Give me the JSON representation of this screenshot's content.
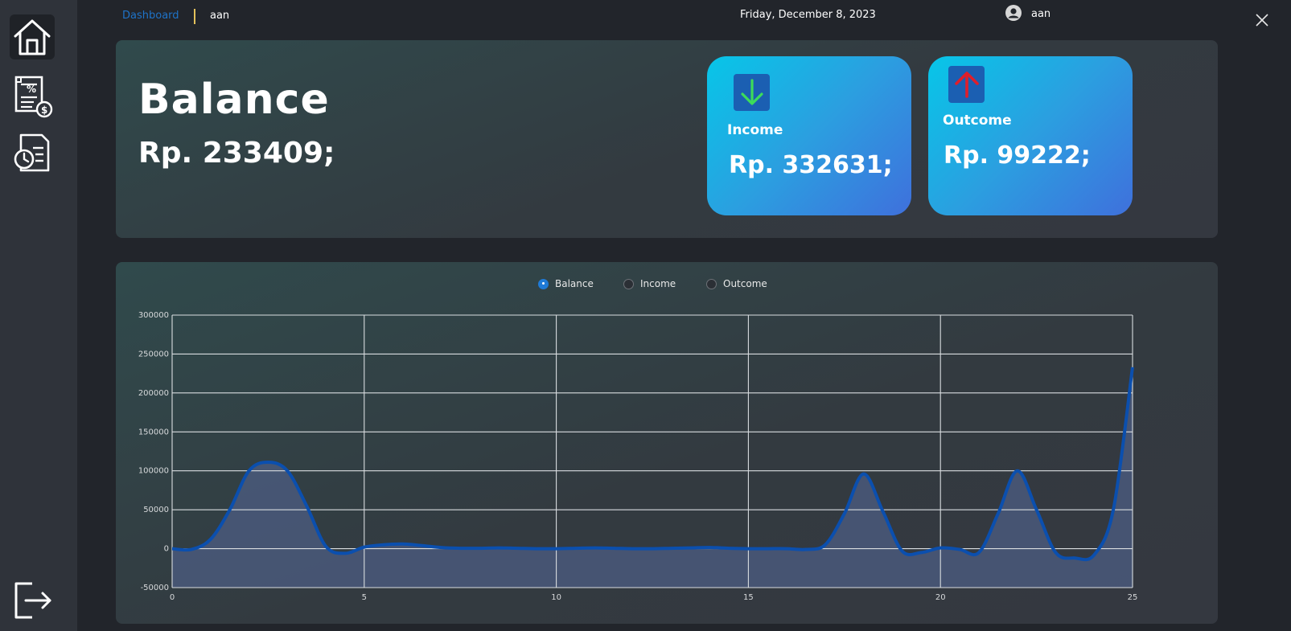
{
  "header": {
    "breadcrumb_link": "Dashboard",
    "breadcrumb_user": "aan",
    "date": "Friday, December 8, 2023",
    "user_name": "aan"
  },
  "sidebar": {
    "items": [
      {
        "icon": "home-icon",
        "active": true
      },
      {
        "icon": "receipt-percent-icon",
        "active": false
      },
      {
        "icon": "document-clock-icon",
        "active": false
      }
    ],
    "logout_icon": "logout-icon"
  },
  "balance": {
    "title": "Balance",
    "amount": "Rp. 233409;"
  },
  "cards": [
    {
      "label": "Income",
      "amount": "Rp. 332631;",
      "icon": "arrow-down-icon",
      "icon_color": "#3ddc5a"
    },
    {
      "label": "Outcome",
      "amount": "Rp. 99222;",
      "icon": "arrow-up-icon",
      "icon_color": "#e01e2b"
    }
  ],
  "radios": [
    {
      "label": "Balance",
      "checked": true
    },
    {
      "label": "Income",
      "checked": false
    },
    {
      "label": "Outcome",
      "checked": false
    }
  ],
  "colors": {
    "accent": "#1f7ad6",
    "line": "#0b4fae",
    "area": "#4f5f87"
  },
  "chart_data": {
    "type": "area",
    "x": [
      0,
      0.5,
      1,
      1.5,
      2,
      2.5,
      3,
      3.5,
      4,
      4.5,
      5,
      5.5,
      6,
      6.5,
      7,
      7.5,
      8,
      8.5,
      9,
      9.5,
      10,
      10.5,
      11,
      11.5,
      12,
      12.5,
      13,
      13.5,
      14,
      14.5,
      15,
      15.5,
      16,
      16.5,
      17,
      17.5,
      18,
      18.5,
      19,
      19.5,
      20,
      20.5,
      21,
      21.5,
      22,
      22.5,
      23,
      23.5,
      24,
      24.5,
      25
    ],
    "series": [
      {
        "values": [
          0,
          -1000,
          12000,
          50000,
          100000,
          111000,
          100000,
          55000,
          3000,
          -6000,
          2000,
          5000,
          6000,
          4000,
          1500,
          500,
          500,
          1000,
          500,
          0,
          0,
          500,
          1000,
          500,
          0,
          0,
          500,
          1000,
          1500,
          500,
          0,
          0,
          0,
          -1000,
          5000,
          45000,
          96000,
          48000,
          -3000,
          -5000,
          1000,
          -1000,
          -5000,
          45000,
          100000,
          50000,
          -5000,
          -12000,
          -8000,
          50000,
          233000
        ]
      }
    ],
    "xlim": [
      0,
      25
    ],
    "ylim": [
      -50000,
      300000
    ],
    "xticks": [
      0,
      5,
      10,
      15,
      20,
      25
    ],
    "yticks": [
      -50000,
      0,
      50000,
      100000,
      150000,
      200000,
      250000,
      300000
    ],
    "grid": true
  }
}
